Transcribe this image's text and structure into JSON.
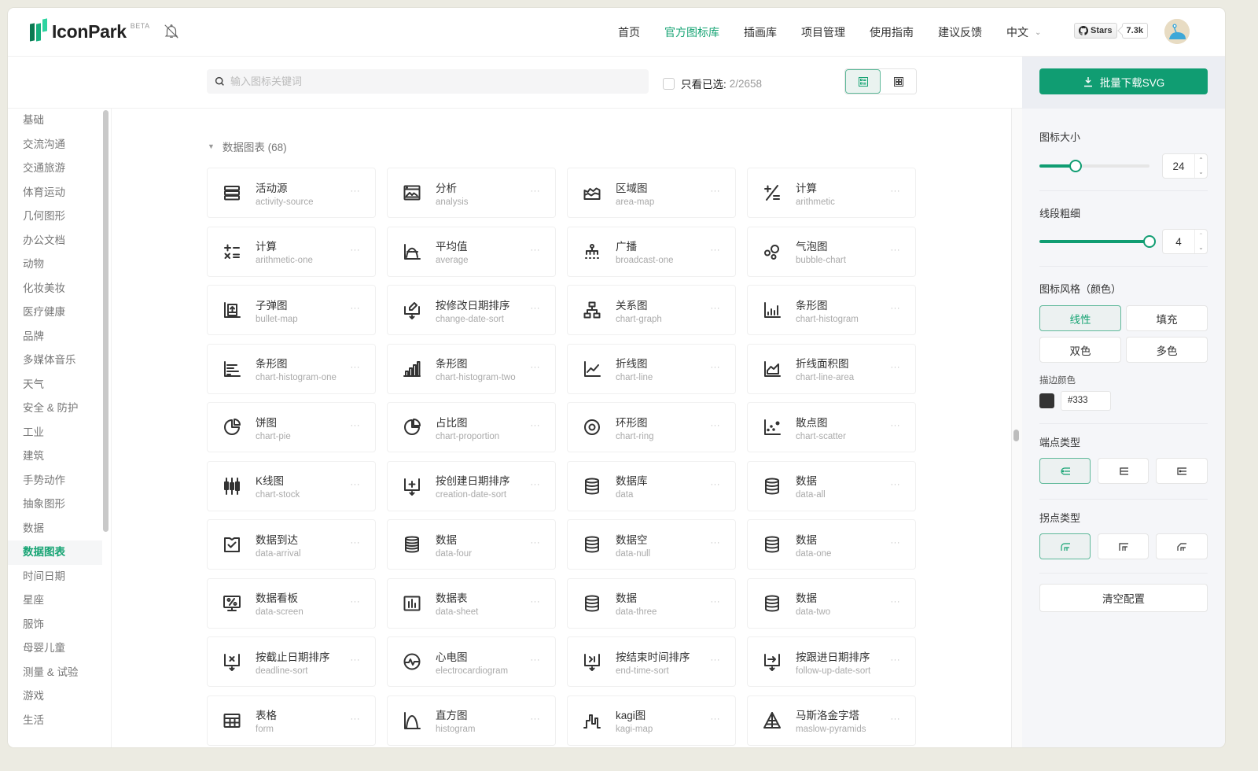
{
  "header": {
    "logo_text": "IconPark",
    "beta_label": "BETA",
    "brand_colors": [
      "#0b7a52",
      "#16b07e",
      "#2dd4a0"
    ],
    "nav": [
      {
        "label": "首页",
        "active": false
      },
      {
        "label": "官方图标库",
        "active": true
      },
      {
        "label": "插画库",
        "active": false
      },
      {
        "label": "项目管理",
        "active": false
      },
      {
        "label": "使用指南",
        "active": false
      },
      {
        "label": "建议反馈",
        "active": false
      }
    ],
    "language": "中文",
    "github_stars_label": "Stars",
    "github_stars_count": "7.3k"
  },
  "toolbar": {
    "search_placeholder": "输入图标关键词",
    "search_value": "",
    "only_selected_label": "只看已选:",
    "selected_count": "2/2658",
    "only_selected_checked": false,
    "view_mode": "detail"
  },
  "sidebar": {
    "items": [
      {
        "label": "基础"
      },
      {
        "label": "交流沟通"
      },
      {
        "label": "交通旅游"
      },
      {
        "label": "体育运动"
      },
      {
        "label": "几何图形"
      },
      {
        "label": "办公文档"
      },
      {
        "label": "动物"
      },
      {
        "label": "化妆美妆"
      },
      {
        "label": "医疗健康"
      },
      {
        "label": "品牌"
      },
      {
        "label": "多媒体音乐"
      },
      {
        "label": "天气"
      },
      {
        "label": "安全 & 防护"
      },
      {
        "label": "工业"
      },
      {
        "label": "建筑"
      },
      {
        "label": "手势动作"
      },
      {
        "label": "抽象图形"
      },
      {
        "label": "数据"
      },
      {
        "label": "数据图表",
        "active": true
      },
      {
        "label": "时间日期"
      },
      {
        "label": "星座"
      },
      {
        "label": "服饰"
      },
      {
        "label": "母婴儿童"
      },
      {
        "label": "测量 & 试验"
      },
      {
        "label": "游戏"
      },
      {
        "label": "生活"
      }
    ]
  },
  "main": {
    "group_title": "数据图表 (68)",
    "icons": [
      {
        "zh": "活动源",
        "en": "activity-source",
        "icon": "activity-source"
      },
      {
        "zh": "分析",
        "en": "analysis",
        "icon": "analysis"
      },
      {
        "zh": "区域图",
        "en": "area-map",
        "icon": "area-map"
      },
      {
        "zh": "计算",
        "en": "arithmetic",
        "icon": "arithmetic"
      },
      {
        "zh": "计算",
        "en": "arithmetic-one",
        "icon": "arithmetic-one"
      },
      {
        "zh": "平均值",
        "en": "average",
        "icon": "average"
      },
      {
        "zh": "广播",
        "en": "broadcast-one",
        "icon": "broadcast-one"
      },
      {
        "zh": "气泡图",
        "en": "bubble-chart",
        "icon": "bubble-chart"
      },
      {
        "zh": "子弹图",
        "en": "bullet-map",
        "icon": "bullet-map"
      },
      {
        "zh": "按修改日期排序",
        "en": "change-date-sort",
        "icon": "change-date-sort"
      },
      {
        "zh": "关系图",
        "en": "chart-graph",
        "icon": "chart-graph"
      },
      {
        "zh": "条形图",
        "en": "chart-histogram",
        "icon": "chart-histogram"
      },
      {
        "zh": "条形图",
        "en": "chart-histogram-one",
        "icon": "chart-histogram-one"
      },
      {
        "zh": "条形图",
        "en": "chart-histogram-two",
        "icon": "chart-histogram-two"
      },
      {
        "zh": "折线图",
        "en": "chart-line",
        "icon": "chart-line"
      },
      {
        "zh": "折线面积图",
        "en": "chart-line-area",
        "icon": "chart-line-area"
      },
      {
        "zh": "饼图",
        "en": "chart-pie",
        "icon": "chart-pie"
      },
      {
        "zh": "占比图",
        "en": "chart-proportion",
        "icon": "chart-proportion"
      },
      {
        "zh": "环形图",
        "en": "chart-ring",
        "icon": "chart-ring"
      },
      {
        "zh": "散点图",
        "en": "chart-scatter",
        "icon": "chart-scatter"
      },
      {
        "zh": "K线图",
        "en": "chart-stock",
        "icon": "chart-stock"
      },
      {
        "zh": "按创建日期排序",
        "en": "creation-date-sort",
        "icon": "creation-date-sort"
      },
      {
        "zh": "数据库",
        "en": "data",
        "icon": "data"
      },
      {
        "zh": "数据",
        "en": "data-all",
        "icon": "data-all"
      },
      {
        "zh": "数据到达",
        "en": "data-arrival",
        "icon": "data-arrival"
      },
      {
        "zh": "数据",
        "en": "data-four",
        "icon": "data-four"
      },
      {
        "zh": "数据空",
        "en": "data-null",
        "icon": "data-null"
      },
      {
        "zh": "数据",
        "en": "data-one",
        "icon": "data-one"
      },
      {
        "zh": "数据看板",
        "en": "data-screen",
        "icon": "data-screen"
      },
      {
        "zh": "数据表",
        "en": "data-sheet",
        "icon": "data-sheet"
      },
      {
        "zh": "数据",
        "en": "data-three",
        "icon": "data-three"
      },
      {
        "zh": "数据",
        "en": "data-two",
        "icon": "data-two"
      },
      {
        "zh": "按截止日期排序",
        "en": "deadline-sort",
        "icon": "deadline-sort"
      },
      {
        "zh": "心电图",
        "en": "electrocardiogram",
        "icon": "electrocardiogram"
      },
      {
        "zh": "按结束时间排序",
        "en": "end-time-sort",
        "icon": "end-time-sort"
      },
      {
        "zh": "按跟进日期排序",
        "en": "follow-up-date-sort",
        "icon": "follow-up-date-sort"
      },
      {
        "zh": "表格",
        "en": "form",
        "icon": "form"
      },
      {
        "zh": "直方图",
        "en": "histogram",
        "icon": "histogram"
      },
      {
        "zh": "kagi图",
        "en": "kagi-map",
        "icon": "kagi-map"
      },
      {
        "zh": "马斯洛金字塔",
        "en": "maslow-pyramids",
        "icon": "maslow-pyramids"
      }
    ],
    "more_label": "···"
  },
  "settings": {
    "download_label": "批量下载SVG",
    "size_label": "图标大小",
    "size_value": 24,
    "size_fraction": 0.33,
    "stroke_label": "线段粗细",
    "stroke_value": 4,
    "stroke_fraction": 1.0,
    "style_label": "图标风格（颜色）",
    "styles": [
      {
        "label": "线性",
        "active": true
      },
      {
        "label": "填充",
        "active": false
      },
      {
        "label": "双色",
        "active": false
      },
      {
        "label": "多色",
        "active": false
      }
    ],
    "stroke_color_label": "描边颜色",
    "stroke_color": "#333",
    "linecap_label": "端点类型",
    "linecap_active_index": 0,
    "linejoin_label": "拐点类型",
    "linejoin_active_index": 0,
    "clear_label": "清空配置",
    "accent_color": "#109d72"
  }
}
